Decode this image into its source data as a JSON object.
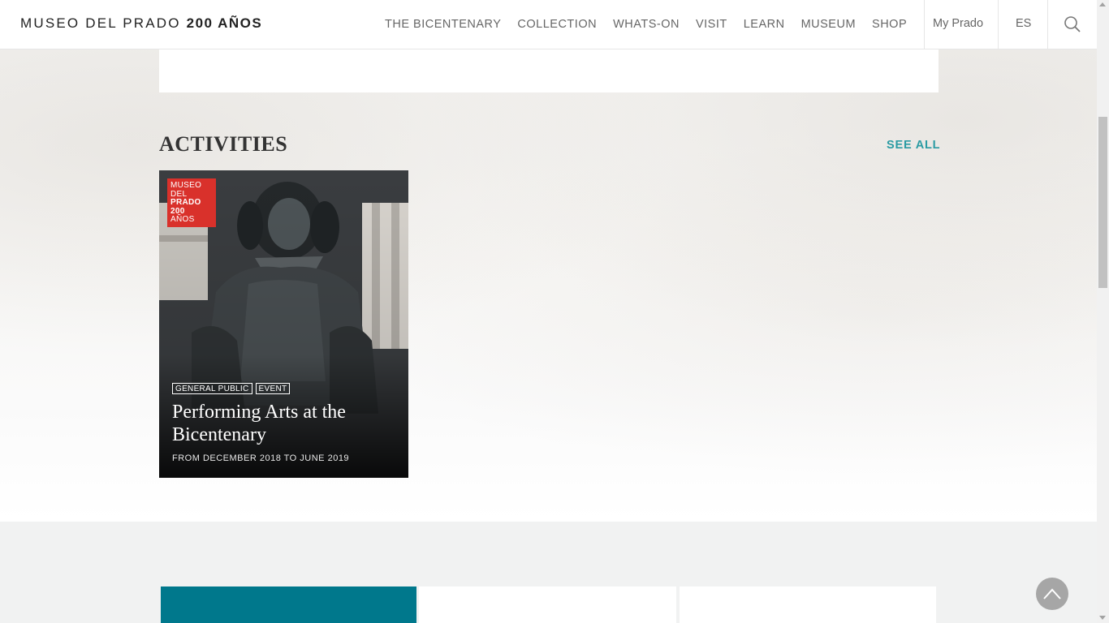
{
  "header": {
    "logo_thin": "MUSEO DEL PRADO",
    "logo_bold": "200 AÑOS",
    "nav": [
      "THE BICENTENARY",
      "COLLECTION",
      "WHATS-ON",
      "VISIT",
      "LEARN",
      "MUSEUM",
      "SHOP"
    ],
    "my_prado": "My Prado",
    "language": "ES",
    "search_icon": "search-icon"
  },
  "activities": {
    "title": "ACTIVITIES",
    "see_all": "SEE ALL",
    "card": {
      "badge": [
        "MUSEO",
        "DEL",
        "PRADO",
        "200",
        "AÑOS"
      ],
      "tags": [
        "GENERAL PUBLIC",
        "EVENT"
      ],
      "title": "Performing Arts at the Bicentenary",
      "date": "FROM DECEMBER 2018 TO JUNE 2019",
      "badge_color": "#d9312b"
    }
  },
  "colors": {
    "accent": "#2a9ba3",
    "tile_teal": "#00788c"
  },
  "icons": {
    "back_to_top": "chevron-up-icon"
  }
}
